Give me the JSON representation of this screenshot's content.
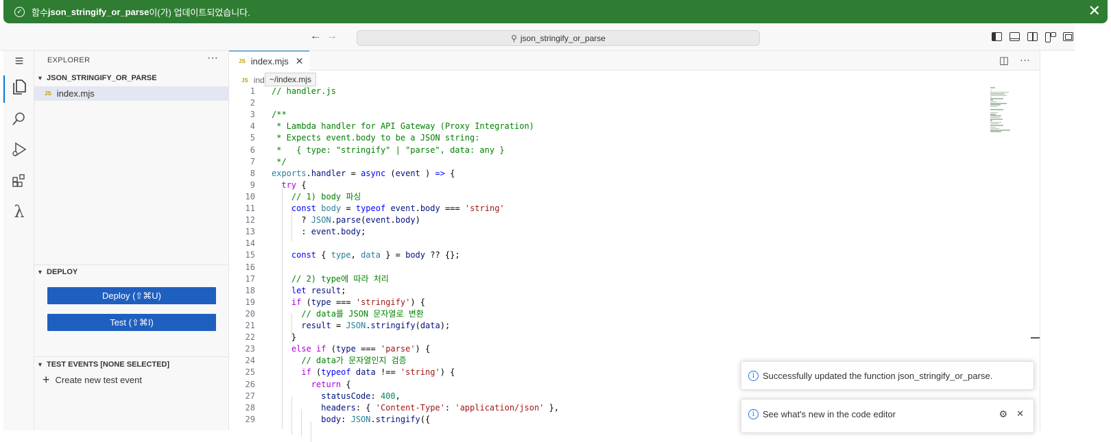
{
  "banner": {
    "prefix": "함수 ",
    "function_name": "json_stringify_or_parse",
    "suffix": "이(가) 업데이트되었습니다."
  },
  "titlebar": {
    "search_text": "json_stringify_or_parse"
  },
  "sidebar": {
    "title": "EXPLORER",
    "folder": "JSON_STRINGIFY_OR_PARSE",
    "file": "index.mjs",
    "deploy_title": "DEPLOY",
    "deploy_button": "Deploy (⇧⌘U)",
    "test_button": "Test (⇧⌘I)",
    "test_events_title": "TEST EVENTS [NONE SELECTED]",
    "create_event": "Create new test event"
  },
  "editor": {
    "tab_label": "index.mjs",
    "breadcrumb": "ind",
    "tooltip": "~/index.mjs",
    "lines": [
      [
        [
          "c-com",
          "// handler.js"
        ]
      ],
      [],
      [
        [
          "c-com",
          "/**"
        ]
      ],
      [
        [
          "c-com",
          " * Lambda handler for API Gateway (Proxy Integration)"
        ]
      ],
      [
        [
          "c-com",
          " * Expects event.body to be a JSON string:"
        ]
      ],
      [
        [
          "c-com",
          " *   { type: \"stringify\" | \"parse\", data: any }"
        ]
      ],
      [
        [
          "c-com",
          " */"
        ]
      ],
      [
        [
          "c-typ",
          "exports"
        ],
        [
          "",
          "."
        ],
        [
          "c-var",
          "handler"
        ],
        [
          "",
          " = "
        ],
        [
          "c-kw",
          "async"
        ],
        [
          "",
          " ("
        ],
        [
          "c-var",
          "event"
        ],
        [
          "",
          " ) "
        ],
        [
          "c-kw",
          "=>"
        ],
        [
          "",
          " {"
        ]
      ],
      [
        [
          "",
          "  "
        ],
        [
          "c-ctrl",
          "try"
        ],
        [
          "",
          " {"
        ]
      ],
      [
        [
          "",
          "    "
        ],
        [
          "c-com",
          "// 1) body 파싱"
        ]
      ],
      [
        [
          "",
          "    "
        ],
        [
          "c-kw",
          "const"
        ],
        [
          "",
          " "
        ],
        [
          "c-typ",
          "body"
        ],
        [
          "",
          " = "
        ],
        [
          "c-kw",
          "typeof"
        ],
        [
          "",
          " "
        ],
        [
          "c-var",
          "event"
        ],
        [
          "",
          "."
        ],
        [
          "c-var",
          "body"
        ],
        [
          "",
          " === "
        ],
        [
          "c-str",
          "'string'"
        ]
      ],
      [
        [
          "",
          "      ? "
        ],
        [
          "c-typ",
          "JSON"
        ],
        [
          "",
          "."
        ],
        [
          "c-var",
          "parse"
        ],
        [
          "",
          "("
        ],
        [
          "c-var",
          "event"
        ],
        [
          "",
          "."
        ],
        [
          "c-var",
          "body"
        ],
        [
          "",
          ")"
        ]
      ],
      [
        [
          "",
          "      : "
        ],
        [
          "c-var",
          "event"
        ],
        [
          "",
          "."
        ],
        [
          "c-var",
          "body"
        ],
        [
          "",
          ";"
        ]
      ],
      [],
      [
        [
          "",
          "    "
        ],
        [
          "c-kw",
          "const"
        ],
        [
          "",
          " { "
        ],
        [
          "c-typ",
          "type"
        ],
        [
          "",
          ", "
        ],
        [
          "c-typ",
          "data"
        ],
        [
          "",
          " } = "
        ],
        [
          "c-var",
          "body"
        ],
        [
          "",
          " ?? {};"
        ]
      ],
      [],
      [
        [
          "",
          "    "
        ],
        [
          "c-com",
          "// 2) type에 따라 처리"
        ]
      ],
      [
        [
          "",
          "    "
        ],
        [
          "c-kw",
          "let"
        ],
        [
          "",
          " "
        ],
        [
          "c-var",
          "result"
        ],
        [
          "",
          ";"
        ]
      ],
      [
        [
          "",
          "    "
        ],
        [
          "c-ctrl",
          "if"
        ],
        [
          "",
          " ("
        ],
        [
          "c-var",
          "type"
        ],
        [
          "",
          " === "
        ],
        [
          "c-str",
          "'stringify'"
        ],
        [
          "",
          ") {"
        ]
      ],
      [
        [
          "",
          "      "
        ],
        [
          "c-com",
          "// data를 JSON 문자열로 변환"
        ]
      ],
      [
        [
          "",
          "      "
        ],
        [
          "c-var",
          "result"
        ],
        [
          "",
          " = "
        ],
        [
          "c-typ",
          "JSON"
        ],
        [
          "",
          "."
        ],
        [
          "c-var",
          "stringify"
        ],
        [
          "",
          "("
        ],
        [
          "c-var",
          "data"
        ],
        [
          "",
          ");"
        ]
      ],
      [
        [
          "",
          "    }"
        ]
      ],
      [
        [
          "",
          "    "
        ],
        [
          "c-ctrl",
          "else if"
        ],
        [
          "",
          " ("
        ],
        [
          "c-var",
          "type"
        ],
        [
          "",
          " === "
        ],
        [
          "c-str",
          "'parse'"
        ],
        [
          "",
          ") {"
        ]
      ],
      [
        [
          "",
          "      "
        ],
        [
          "c-com",
          "// data가 문자열인지 검증"
        ]
      ],
      [
        [
          "",
          "      "
        ],
        [
          "c-ctrl",
          "if"
        ],
        [
          "",
          " ("
        ],
        [
          "c-kw",
          "typeof"
        ],
        [
          "",
          " "
        ],
        [
          "c-var",
          "data"
        ],
        [
          "",
          " !== "
        ],
        [
          "c-str",
          "'string'"
        ],
        [
          "",
          ") {"
        ]
      ],
      [
        [
          "",
          "        "
        ],
        [
          "c-ctrl",
          "return"
        ],
        [
          "",
          " {"
        ]
      ],
      [
        [
          "",
          "          "
        ],
        [
          "c-var",
          "statusCode"
        ],
        [
          "",
          ": "
        ],
        [
          "c-num",
          "400"
        ],
        [
          "",
          ","
        ]
      ],
      [
        [
          "",
          "          "
        ],
        [
          "c-var",
          "headers"
        ],
        [
          "",
          ": { "
        ],
        [
          "c-str",
          "'Content-Type'"
        ],
        [
          "",
          ": "
        ],
        [
          "c-str",
          "'application/json'"
        ],
        [
          "",
          " },"
        ]
      ],
      [
        [
          "",
          "          "
        ],
        [
          "c-var",
          "body"
        ],
        [
          "",
          ": "
        ],
        [
          "c-typ",
          "JSON"
        ],
        [
          "",
          "."
        ],
        [
          "c-var",
          "stringify"
        ],
        [
          "",
          "({"
        ]
      ]
    ]
  },
  "toasts": {
    "success": "Successfully updated the function json_stringify_or_parse.",
    "whats_new": "See what's new in the code editor"
  }
}
